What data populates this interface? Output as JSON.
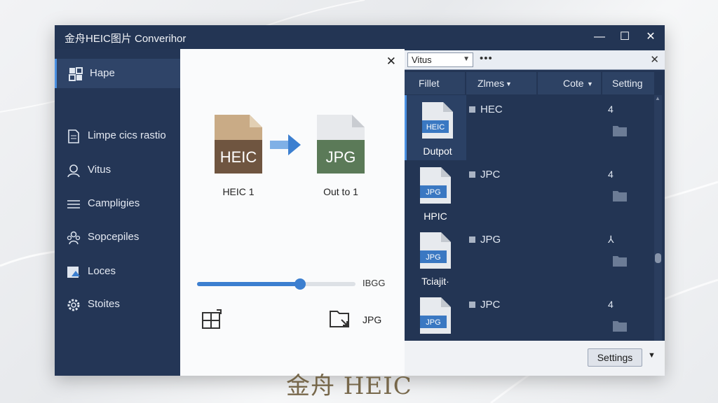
{
  "app": {
    "title": "金舟HEIC图片 Converihor"
  },
  "window_controls": {
    "minimize": "—",
    "maximize": "☐",
    "close": "✕"
  },
  "sidebar": {
    "items": [
      {
        "label": "Hape",
        "icon": "grid-icon"
      },
      {
        "label": "Limpe cics rastio",
        "icon": "document-icon"
      },
      {
        "label": "Vitus",
        "icon": "user-icon"
      },
      {
        "label": "Campligies",
        "icon": "list-icon"
      },
      {
        "label": "Sopcepiles",
        "icon": "people-icon"
      },
      {
        "label": "Loces",
        "icon": "image-upload-icon"
      },
      {
        "label": "Stoites",
        "icon": "gear-icon"
      }
    ]
  },
  "converter": {
    "close": "✕",
    "source": {
      "badge": "HEIC",
      "label": "HEIC 1",
      "color": "#6f5540"
    },
    "target": {
      "badge": "JPG",
      "label": "Out to 1",
      "color": "#5b7a58"
    },
    "quality": {
      "value_percent": 65,
      "label": "IBGG"
    },
    "output_format": "JPG"
  },
  "file_panel": {
    "filter_select": "Vitus",
    "more": "•••",
    "close": "✕",
    "columns": {
      "file": "Fillet",
      "name": "Zlmes",
      "date": "Cote",
      "settings": "Setting"
    },
    "rows": [
      {
        "badge": "HEIC",
        "caption": "Dutpot",
        "type": "HEC",
        "count": "4",
        "selected": true
      },
      {
        "badge": "JPG",
        "caption": "HPIC",
        "type": "JPC",
        "count": "4",
        "selected": false
      },
      {
        "badge": "JPG",
        "caption": "Tciajit·",
        "type": "JPG",
        "count": "⅄",
        "selected": false
      },
      {
        "badge": "JPG",
        "caption": "",
        "type": "JPC",
        "count": "4",
        "selected": false
      }
    ],
    "scroll_up": "▲",
    "scroll_down": "▼"
  },
  "footer": {
    "settings_label": "Settings",
    "dropdown": "▼",
    "watermark": "金舟 HEIC"
  },
  "colors": {
    "accent": "#3c7fd0",
    "window_bg": "#233554",
    "panel_light": "#fafbfc"
  }
}
